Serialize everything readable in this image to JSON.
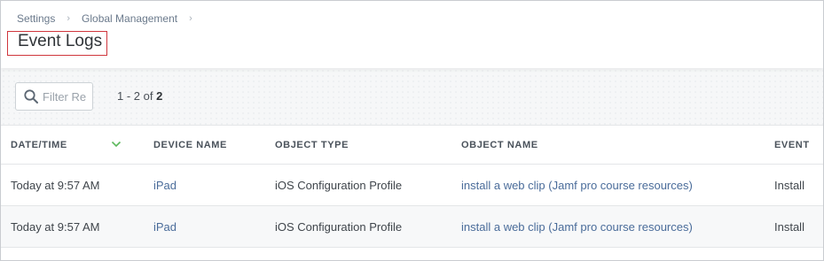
{
  "breadcrumb": {
    "items": [
      "Settings",
      "Global Management"
    ],
    "separator": "›"
  },
  "page": {
    "title": "Event Logs"
  },
  "toolbar": {
    "filter_placeholder": "Filter Re",
    "filter_value": "",
    "count_range": "1 - 2 of ",
    "count_total": "2"
  },
  "table": {
    "columns": [
      "DATE/TIME",
      "DEVICE NAME",
      "OBJECT TYPE",
      "OBJECT NAME",
      "EVENT"
    ],
    "sort_column": "DATE/TIME",
    "sort_direction": "descending",
    "rows": [
      {
        "date_time": "Today at 9:57 AM",
        "device_name": "iPad",
        "object_type": "iOS Configuration Profile",
        "object_name": "install a web clip (Jamf pro course resources)",
        "event": "Install"
      },
      {
        "date_time": "Today at 9:57 AM",
        "device_name": "iPad",
        "object_type": "iOS Configuration Profile",
        "object_name": "install a web clip (Jamf pro course resources)",
        "event": "Install"
      }
    ]
  },
  "colors": {
    "link": "#4a6c9a",
    "sort_icon": "#5cb85c",
    "highlight_box": "#d0363d"
  },
  "icons": {
    "filter": "search-icon",
    "sort": "chevron-down-icon",
    "breadcrumb_separator": "chevron-right-icon"
  }
}
